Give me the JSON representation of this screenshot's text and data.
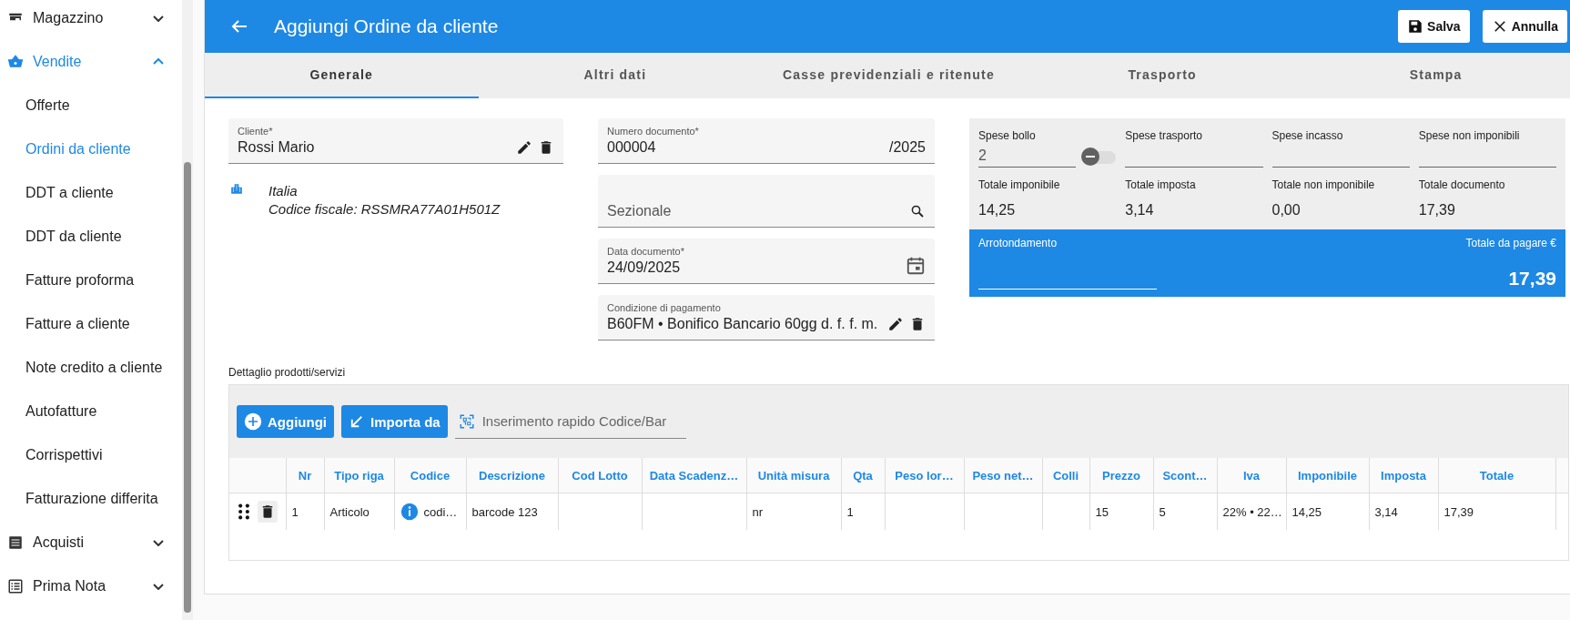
{
  "sidebar": {
    "groups": [
      {
        "label": "Magazzino",
        "expanded": false
      },
      {
        "label": "Vendite",
        "expanded": true,
        "children": [
          {
            "label": "Offerte",
            "selected": false
          },
          {
            "label": "Ordini da cliente",
            "selected": true
          },
          {
            "label": "DDT a cliente",
            "selected": false
          },
          {
            "label": "DDT da cliente",
            "selected": false
          },
          {
            "label": "Fatture proforma",
            "selected": false
          },
          {
            "label": "Fatture a cliente",
            "selected": false
          },
          {
            "label": "Note credito a cliente",
            "selected": false
          },
          {
            "label": "Autofatture",
            "selected": false
          },
          {
            "label": "Corrispettivi",
            "selected": false
          },
          {
            "label": "Fatturazione differita",
            "selected": false
          }
        ]
      },
      {
        "label": "Acquisti",
        "expanded": false
      },
      {
        "label": "Prima Nota",
        "expanded": false
      }
    ]
  },
  "header": {
    "title": "Aggiungi Ordine da cliente",
    "buttons": [
      {
        "label": "Salva",
        "kind": "save"
      },
      {
        "label": "Annulla",
        "kind": "cancel"
      }
    ]
  },
  "tabs": [
    {
      "label": "Generale",
      "selected": true
    },
    {
      "label": "Altri dati",
      "selected": false
    },
    {
      "label": "Casse previdenziali e ritenute",
      "selected": false
    },
    {
      "label": "Trasporto",
      "selected": false
    },
    {
      "label": "Stampa",
      "selected": false
    }
  ],
  "cliente": {
    "label": "Cliente*",
    "value": "Rossi Mario",
    "country": "Italia",
    "fiscal_code": "Codice fiscale: RSSMRA77A01H501Z"
  },
  "document_fields": [
    {
      "kind": "number",
      "label": "Numero documento*",
      "value": "000004",
      "suffix": "/2025"
    },
    {
      "kind": "search",
      "placeholder": "Sezionale"
    },
    {
      "kind": "date",
      "label": "Data documento*",
      "value": "24/09/2025"
    },
    {
      "kind": "payment",
      "label": "Condizione di pagamento",
      "value": "B60FM • Bonifico Bancario 60gg d. f. f. m."
    }
  ],
  "totals": {
    "expenses": [
      {
        "kind": "switch_field",
        "label": "Spese bollo",
        "value": "2",
        "on": false
      },
      {
        "kind": "field",
        "label": "Spese trasporto"
      },
      {
        "kind": "field",
        "label": "Spese incasso"
      },
      {
        "kind": "field",
        "label": "Spese non imponibili"
      }
    ],
    "sums": [
      {
        "label": "Totale imponibile",
        "value": "14,25"
      },
      {
        "label": "Totale imposta",
        "value": "3,14"
      },
      {
        "label": "Totale non imponibile",
        "value": "0,00"
      },
      {
        "label": "Totale documento",
        "value": "17,39"
      }
    ],
    "rounding_label": "Arrotondamento",
    "to_pay_label": "Totale da pagare €",
    "to_pay_value": "17,39"
  },
  "detail": {
    "title": "Dettaglio prodotti/servizi",
    "buttons": [
      {
        "label": "Aggiungi",
        "kind": "add"
      },
      {
        "label": "Importa da",
        "kind": "import"
      }
    ],
    "quick_entry_placeholder": "Inserimento rapido Codice/Bar",
    "columns": [
      "Nr",
      "Tipo riga",
      "Codice",
      "Descrizione",
      "Cod Lotto",
      "Data Scadenz…",
      "Unità misura",
      "Qta",
      "Peso lor…",
      "Peso net…",
      "Colli",
      "Prezzo",
      "Scont…",
      "Iva",
      "Imponibile",
      "Imposta",
      "Totale"
    ],
    "rows": [
      {
        "cells": [
          "1",
          "Articolo",
          "codi…",
          "barcode 123",
          "",
          "",
          "nr",
          "1",
          "",
          "",
          "",
          "15",
          "5",
          "22% • 22…",
          "14,25",
          "3,14",
          "17,39"
        ]
      }
    ]
  }
}
